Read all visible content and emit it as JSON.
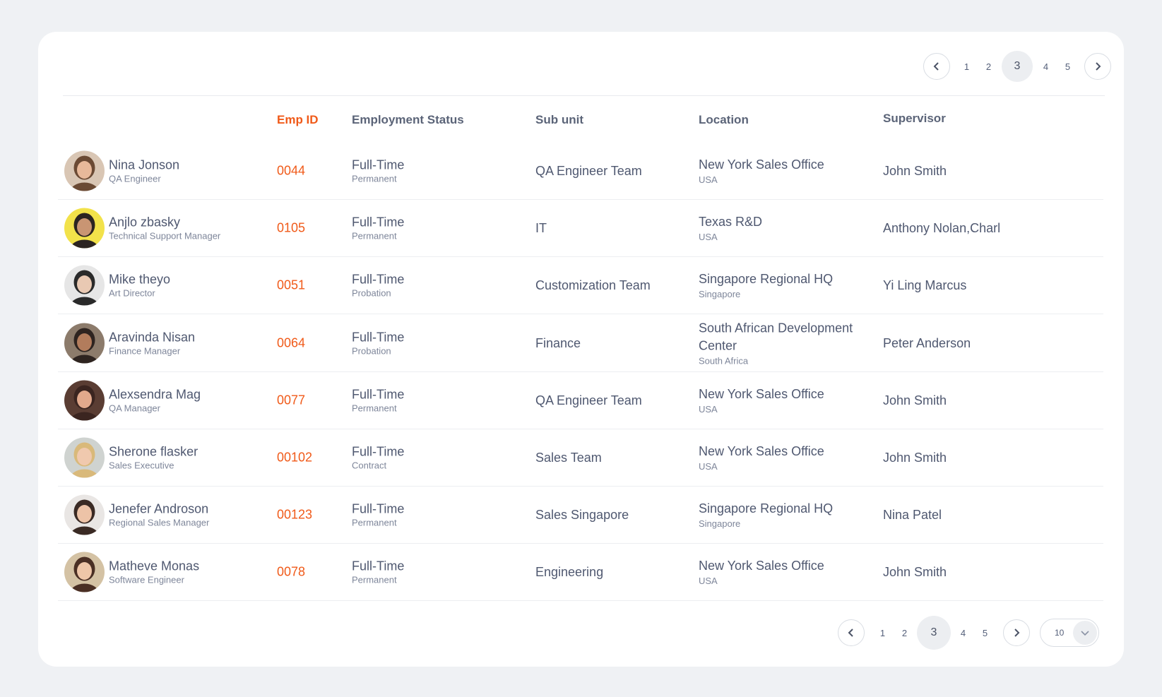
{
  "pagination": {
    "pages": [
      "1",
      "2",
      "3",
      "4",
      "5"
    ],
    "active": "3",
    "per_page": "10"
  },
  "table": {
    "headers": {
      "emp_id": "Emp ID",
      "status": "Employment Status",
      "subunit": "Sub unit",
      "location": "Location",
      "supervisor": "Supervisor"
    },
    "rows": [
      {
        "name": "Nina Jonson",
        "title": "QA Engineer",
        "emp_id": "0044",
        "status": "Full-Time",
        "status_type": "Permanent",
        "subunit": "QA Engineer Team",
        "location": "New York Sales Office",
        "country": "USA",
        "supervisor": "John Smith"
      },
      {
        "name": "Anjlo zbasky",
        "title": "Technical Support Manager",
        "emp_id": "0105",
        "status": "Full-Time",
        "status_type": "Permanent",
        "subunit": "IT",
        "location": "Texas R&D",
        "country": "USA",
        "supervisor": "Anthony Nolan,Charl"
      },
      {
        "name": "Mike theyo",
        "title": "Art Director",
        "emp_id": "0051",
        "status": "Full-Time",
        "status_type": "Probation",
        "subunit": "Customization Team",
        "location": "Singapore Regional HQ",
        "country": "Singapore",
        "supervisor": "Yi Ling Marcus"
      },
      {
        "name": "Aravinda Nisan",
        "title": "Finance Manager",
        "emp_id": "0064",
        "status": "Full-Time",
        "status_type": "Probation",
        "subunit": "Finance",
        "location": "South African Development Center",
        "country": "South Africa",
        "supervisor": "Peter Anderson"
      },
      {
        "name": "Alexsendra Mag",
        "title": "QA Manager",
        "emp_id": "0077",
        "status": "Full-Time",
        "status_type": "Permanent",
        "subunit": "QA Engineer Team",
        "location": "New York Sales Office",
        "country": "USA",
        "supervisor": "John Smith"
      },
      {
        "name": "Sherone flasker",
        "title": "Sales Executive",
        "emp_id": "00102",
        "status": "Full-Time",
        "status_type": "Contract",
        "subunit": "Sales Team",
        "location": "New York Sales Office",
        "country": "USA",
        "supervisor": "John Smith"
      },
      {
        "name": "Jenefer Androson",
        "title": "Regional Sales Manager",
        "emp_id": "00123",
        "status": "Full-Time",
        "status_type": "Permanent",
        "subunit": "Sales Singapore",
        "location": "Singapore Regional HQ",
        "country": "Singapore",
        "supervisor": "Nina Patel"
      },
      {
        "name": "Matheve Monas",
        "title": "Software Engineer",
        "emp_id": "0078",
        "status": "Full-Time",
        "status_type": "Permanent",
        "subunit": "Engineering",
        "location": "New York Sales Office",
        "country": "USA",
        "supervisor": "John Smith"
      }
    ]
  },
  "avatars": [
    {
      "bg": "#d9c6b4",
      "skin": "#e8b99a",
      "hair": "#6b4a34"
    },
    {
      "bg": "#f2e24a",
      "skin": "#c99573",
      "hair": "#2b2421"
    },
    {
      "bg": "#e6e6e6",
      "skin": "#e9c9b3",
      "hair": "#2a2a2a"
    },
    {
      "bg": "#8c7b6b",
      "skin": "#b27c5c",
      "hair": "#2e2420"
    },
    {
      "bg": "#5a3d33",
      "skin": "#e2a98c",
      "hair": "#3b2520"
    },
    {
      "bg": "#cfd3d0",
      "skin": "#f0c9ae",
      "hair": "#d9b97a"
    },
    {
      "bg": "#e9e6e4",
      "skin": "#edc3a7",
      "hair": "#3a2a24"
    },
    {
      "bg": "#d4c2a4",
      "skin": "#eec6a8",
      "hair": "#4a2f24"
    }
  ],
  "colors": {
    "accent": "#f05a19",
    "text": "#4f5870"
  }
}
